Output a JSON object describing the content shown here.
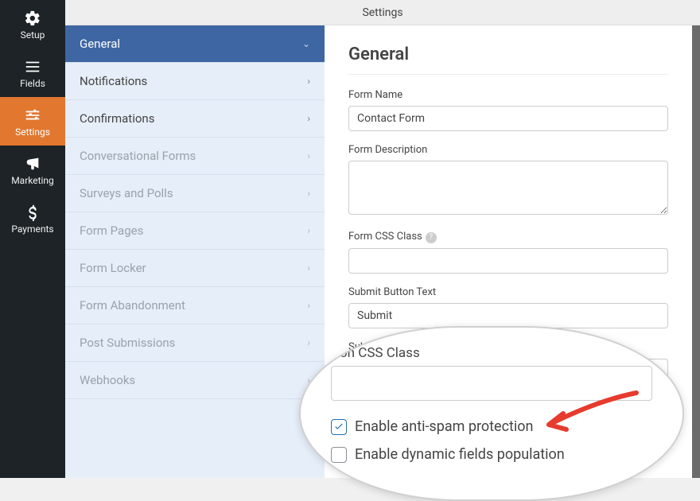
{
  "topbar": {
    "title": "Settings"
  },
  "leftnav": {
    "items": [
      {
        "label": "Setup"
      },
      {
        "label": "Fields"
      },
      {
        "label": "Settings"
      },
      {
        "label": "Marketing"
      },
      {
        "label": "Payments"
      }
    ]
  },
  "sidemenu": {
    "items": [
      {
        "label": "General"
      },
      {
        "label": "Notifications"
      },
      {
        "label": "Confirmations"
      },
      {
        "label": "Conversational Forms"
      },
      {
        "label": "Surveys and Polls"
      },
      {
        "label": "Form Pages"
      },
      {
        "label": "Form Locker"
      },
      {
        "label": "Form Abandonment"
      },
      {
        "label": "Post Submissions"
      },
      {
        "label": "Webhooks"
      }
    ]
  },
  "panel": {
    "heading": "General",
    "form_name_label": "Form Name",
    "form_name_value": "Contact Form",
    "form_desc_label": "Form Description",
    "form_desc_value": "",
    "form_css_label": "Form CSS Class",
    "form_css_value": "",
    "submit_text_label": "Submit Button Text",
    "submit_text_value": "Submit",
    "submit_processing_label": "Submit Button Processing Text"
  },
  "zoom": {
    "css_class_label": "tton CSS Class",
    "antispam_label": "Enable anti-spam protection",
    "antispam_checked": true,
    "dynamic_label": "Enable dynamic fields population",
    "dynamic_checked": false
  }
}
